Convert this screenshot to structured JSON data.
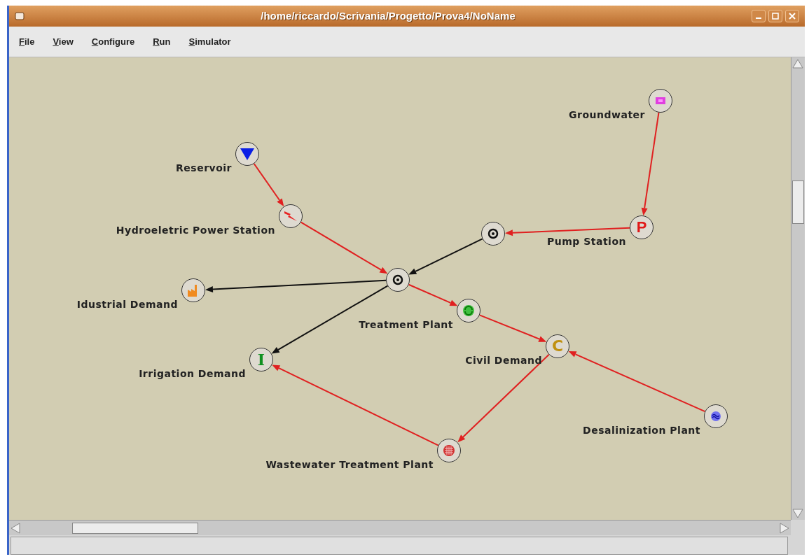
{
  "window": {
    "title": "/home/riccardo/Scrivania/Progetto/Prova4/NoName"
  },
  "menu": [
    {
      "label": "File"
    },
    {
      "label": "View"
    },
    {
      "label": "Configure"
    },
    {
      "label": "Run"
    },
    {
      "label": "Simulator"
    }
  ],
  "nodes": [
    {
      "kind": "groundwater",
      "label": "Groundwater"
    },
    {
      "kind": "reservoir",
      "label": "Reservoir"
    },
    {
      "kind": "hydro",
      "label": "Hydroeletric Power Station"
    },
    {
      "kind": "pump",
      "label": "Pump Station",
      "glyph": "P"
    },
    {
      "kind": "junction"
    },
    {
      "kind": "junction"
    },
    {
      "kind": "industrial",
      "label": "Idustrial Demand"
    },
    {
      "kind": "treatment",
      "label": "Treatment Plant"
    },
    {
      "kind": "civil",
      "label": "Civil Demand",
      "glyph": "C"
    },
    {
      "kind": "irrigation",
      "label": "Irrigation Demand",
      "glyph": "I"
    },
    {
      "kind": "desalinization",
      "label": "Desalinization Plant"
    },
    {
      "kind": "wastewater",
      "label": "Wastewater Treatment Plant"
    }
  ],
  "edges": [
    {
      "color": "#e02020"
    },
    {
      "color": "#e02020"
    },
    {
      "color": "#e02020"
    },
    {
      "color": "#e02020"
    },
    {
      "color": "#111111"
    },
    {
      "color": "#111111"
    },
    {
      "color": "#111111"
    },
    {
      "color": "#e02020"
    },
    {
      "color": "#e02020"
    },
    {
      "color": "#e02020"
    },
    {
      "color": "#e02020"
    },
    {
      "color": "#e02020"
    }
  ]
}
